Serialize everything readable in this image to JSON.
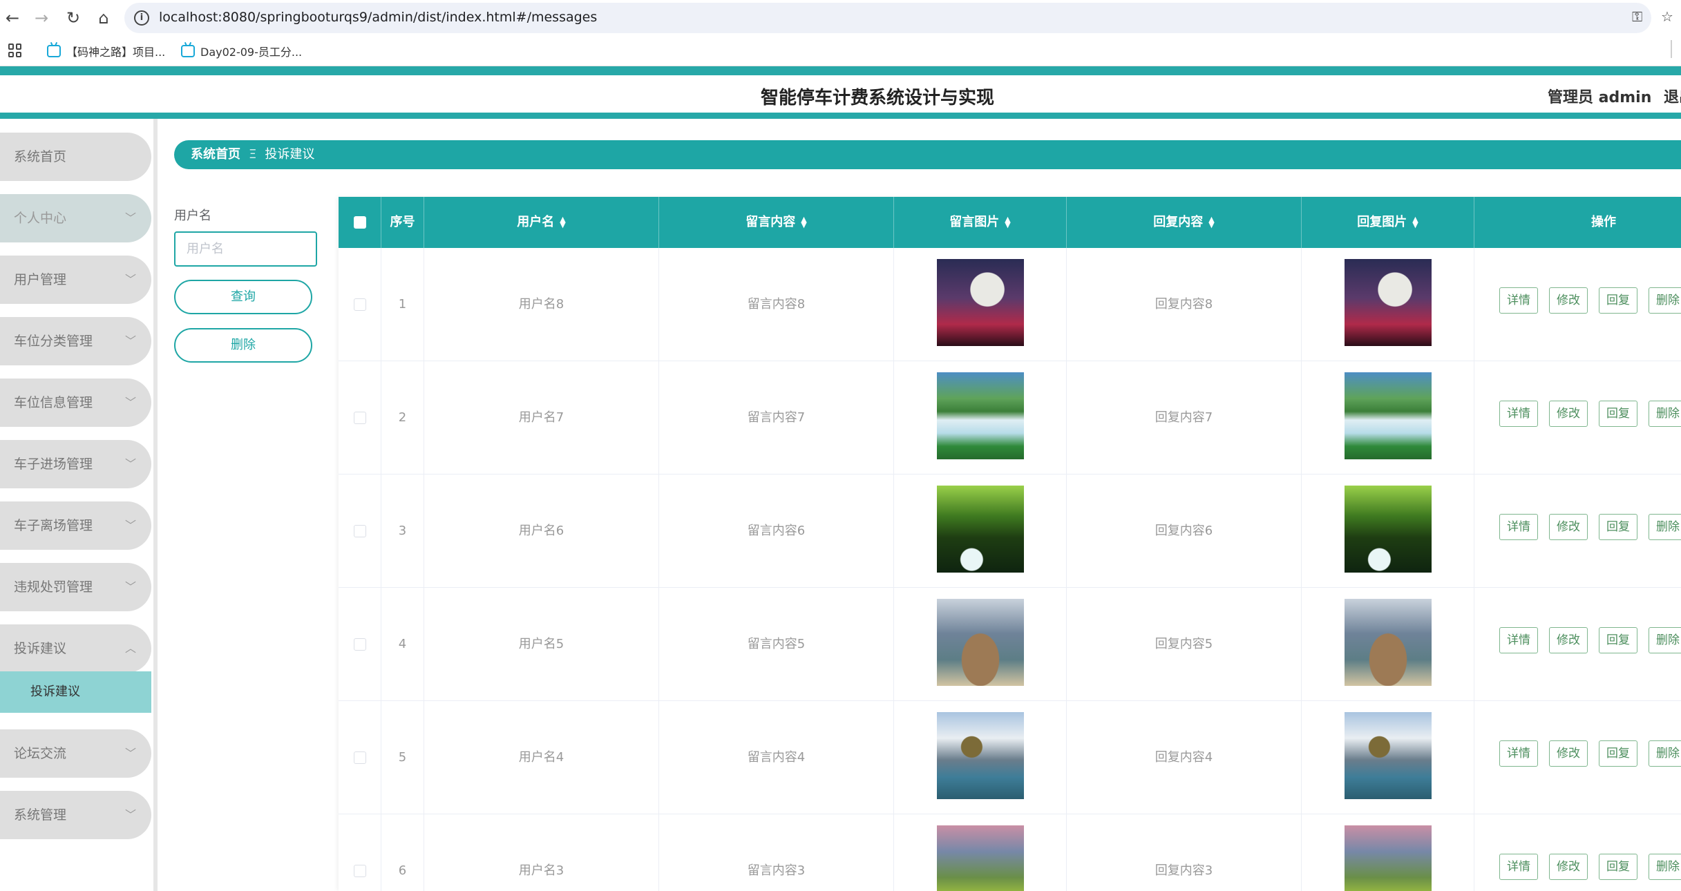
{
  "browser": {
    "url": "localhost:8080/springbooturqs9/admin/dist/index.html#/messages",
    "bookmarks": [
      "【码神之路】项目...",
      "Day02-09-员工分..."
    ]
  },
  "header": {
    "title": "智能停车计费系统设计与实现",
    "user": "管理员 admin",
    "logout": "退出"
  },
  "sidebar": {
    "items": [
      {
        "label": "系统首页"
      },
      {
        "label": "个人中心"
      },
      {
        "label": "用户管理"
      },
      {
        "label": "车位分类管理"
      },
      {
        "label": "车位信息管理"
      },
      {
        "label": "车子进场管理"
      },
      {
        "label": "车子离场管理"
      },
      {
        "label": "违规处罚管理"
      },
      {
        "label": "投诉建议"
      },
      {
        "label": "论坛交流"
      },
      {
        "label": "系统管理"
      }
    ],
    "active_sub": "投诉建议"
  },
  "breadcrumb": {
    "home": "系统首页",
    "separator": "Ξ",
    "current": "投诉建议"
  },
  "filter": {
    "label": "用户名",
    "placeholder": "用户名",
    "query_button": "查询",
    "delete_button": "删除"
  },
  "table": {
    "columns": [
      "序号",
      "用户名",
      "留言内容",
      "留言图片",
      "回复内容",
      "回复图片",
      "操作"
    ],
    "rows": [
      {
        "index": "1",
        "username": "用户名8",
        "message": "留言内容8",
        "reply": "回复内容8",
        "image": "moon"
      },
      {
        "index": "2",
        "username": "用户名7",
        "message": "留言内容7",
        "reply": "回复内容7",
        "image": "waterfall"
      },
      {
        "index": "3",
        "username": "用户名6",
        "message": "留言内容6",
        "reply": "回复内容6",
        "image": "forest"
      },
      {
        "index": "4",
        "username": "用户名5",
        "message": "留言内容5",
        "reply": "回复内容5",
        "image": "sea-arch"
      },
      {
        "index": "5",
        "username": "用户名4",
        "message": "留言内容4",
        "reply": "回复内容4",
        "image": "lake"
      },
      {
        "index": "6",
        "username": "用户名3",
        "message": "留言内容3",
        "reply": "回复内容3",
        "image": "meadow"
      }
    ],
    "actions": [
      "详情",
      "修改",
      "回复",
      "删除"
    ]
  },
  "colors": {
    "accent": "#1ea6a5",
    "header_bar": "#27a8a8",
    "active_sub": "#8ed3d3",
    "op_border": "#7fb68e"
  }
}
